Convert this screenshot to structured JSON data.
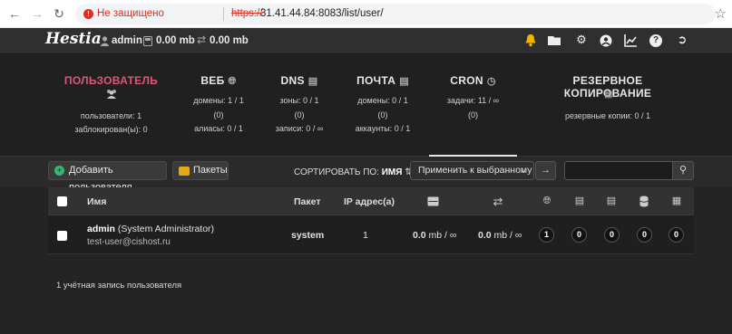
{
  "browser": {
    "security_label": "Не защищено",
    "url_scheme": "https://",
    "url_rest": "31.41.44.84:8083/list/user/"
  },
  "topbar": {
    "logo": "Hestia",
    "user": "admin",
    "disk": "0.00 mb",
    "bandwidth": "0.00 mb"
  },
  "tabs": [
    {
      "title": "ПОЛЬЗОВАТЕЛЬ",
      "lines": [
        "пользователи: 1",
        "заблокирован(ы): 0"
      ]
    },
    {
      "title": "ВЕБ",
      "lines": [
        "домены: 1 / 1",
        "(0)",
        "алиасы: 0 / 1"
      ]
    },
    {
      "title": "DNS",
      "lines": [
        "зоны: 0 / 1",
        "(0)",
        "записи: 0 / ∞"
      ]
    },
    {
      "title": "ПОЧТА",
      "lines": [
        "домены: 0 / 1",
        "(0)",
        "аккаунты: 0 / 1"
      ]
    },
    {
      "title": "CRON",
      "lines": [
        "задачи: 11 / ∞",
        "(0)"
      ]
    },
    {
      "title": "РЕЗЕРВНОЕ КОПИРОВАНИЕ",
      "lines": [
        "резервные копии: 0 / 1"
      ]
    }
  ],
  "toolbar": {
    "add_user": "Добавить пользователя",
    "packages": "Пакеты",
    "sort_label": "СОРТИРОВАТЬ ПО:",
    "sort_value": "ИМЯ",
    "bulk_action": "Применить к выбранному",
    "search_value": ""
  },
  "table": {
    "headers": {
      "name": "Имя",
      "package": "Пакет",
      "ip": "IP адрес(а)"
    },
    "rows": [
      {
        "username": "admin",
        "fullname": "(System Administrator)",
        "email": "test-user@cishost.ru",
        "package": "system",
        "ip": "1",
        "disk_value": "0.0",
        "disk_unit": "mb / ∞",
        "bw_value": "0.0",
        "bw_unit": "mb / ∞",
        "web": "1",
        "dns": "0",
        "mail": "0",
        "db": "0",
        "backup": "0"
      }
    ]
  },
  "footer": "1 учётная запись пользователя",
  "colors": {
    "accent": "#e0557a",
    "background": "#242424"
  }
}
